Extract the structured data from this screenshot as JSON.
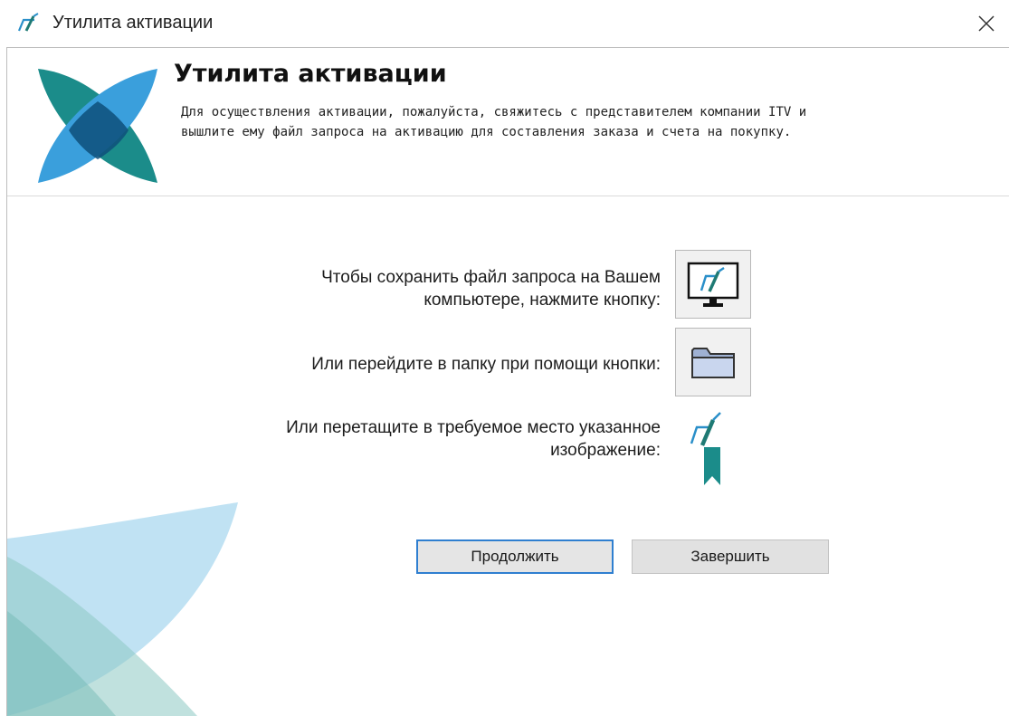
{
  "window": {
    "title": "Утилита активации",
    "close_glyph": "✕"
  },
  "header": {
    "title": "Утилита активации",
    "description_line1": "Для осуществления активации, пожалуйста, свяжитесь с представителем компании ITV и",
    "description_line2": "вышлите ему файл запроса на активацию для составления заказа и счета на покупку."
  },
  "actions": {
    "save_line1": "Чтобы сохранить файл запроса на Вашем",
    "save_line2": "компьютере, нажмите кнопку:",
    "folder_label": "Или перейдите в папку при помощи кнопки:",
    "drag_line1": "Или перетащите в требуемое место указанное",
    "drag_line2": "изображение:"
  },
  "buttons": {
    "continue_label": "Продолжить",
    "finish_label": "Завершить"
  },
  "icons": {
    "app": "itv-logo-icon",
    "save": "monitor-icon",
    "folder": "folder-icon",
    "drag": "activation-bookmark-icon",
    "close": "close-icon"
  },
  "colors": {
    "accent_blue": "#2f7fd0",
    "logo_teal": "#1b8c8a",
    "logo_blue": "#3a9fdc",
    "logo_dark": "#0e4f7a"
  }
}
